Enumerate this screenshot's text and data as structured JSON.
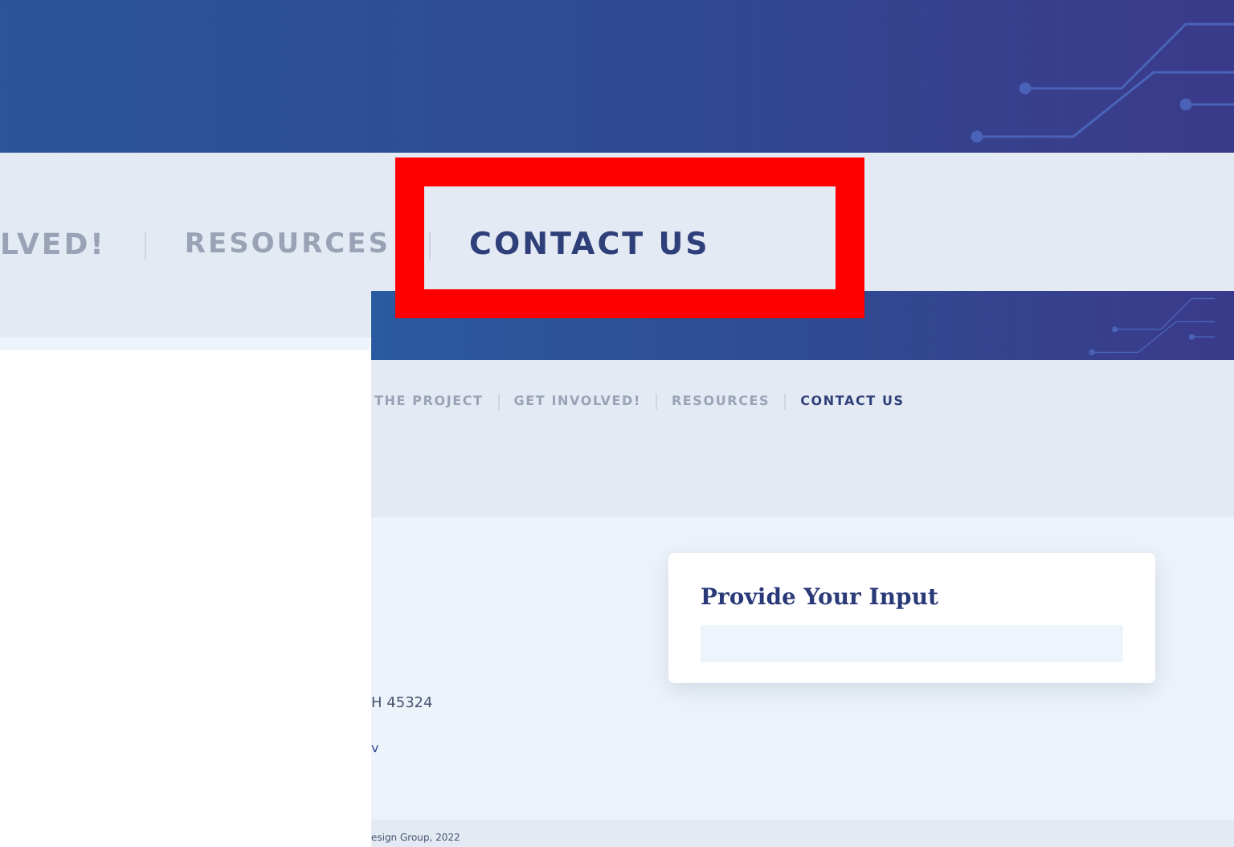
{
  "zoomed_nav": {
    "items": [
      {
        "label": "LVED!",
        "selected": false
      },
      {
        "label": "RESOURCES",
        "selected": false
      },
      {
        "label": "CONTACT US",
        "selected": true
      }
    ]
  },
  "inset": {
    "nav": {
      "items": [
        {
          "label": "THE PROJECT",
          "selected": false
        },
        {
          "label": "GET INVOLVED!",
          "selected": false
        },
        {
          "label": "RESOURCES",
          "selected": false
        },
        {
          "label": "CONTACT US",
          "selected": true
        }
      ]
    },
    "address_line": "H 45324",
    "link": "v",
    "card": {
      "title": "Provide Your Input"
    },
    "footer": "esign Group, 2022"
  }
}
